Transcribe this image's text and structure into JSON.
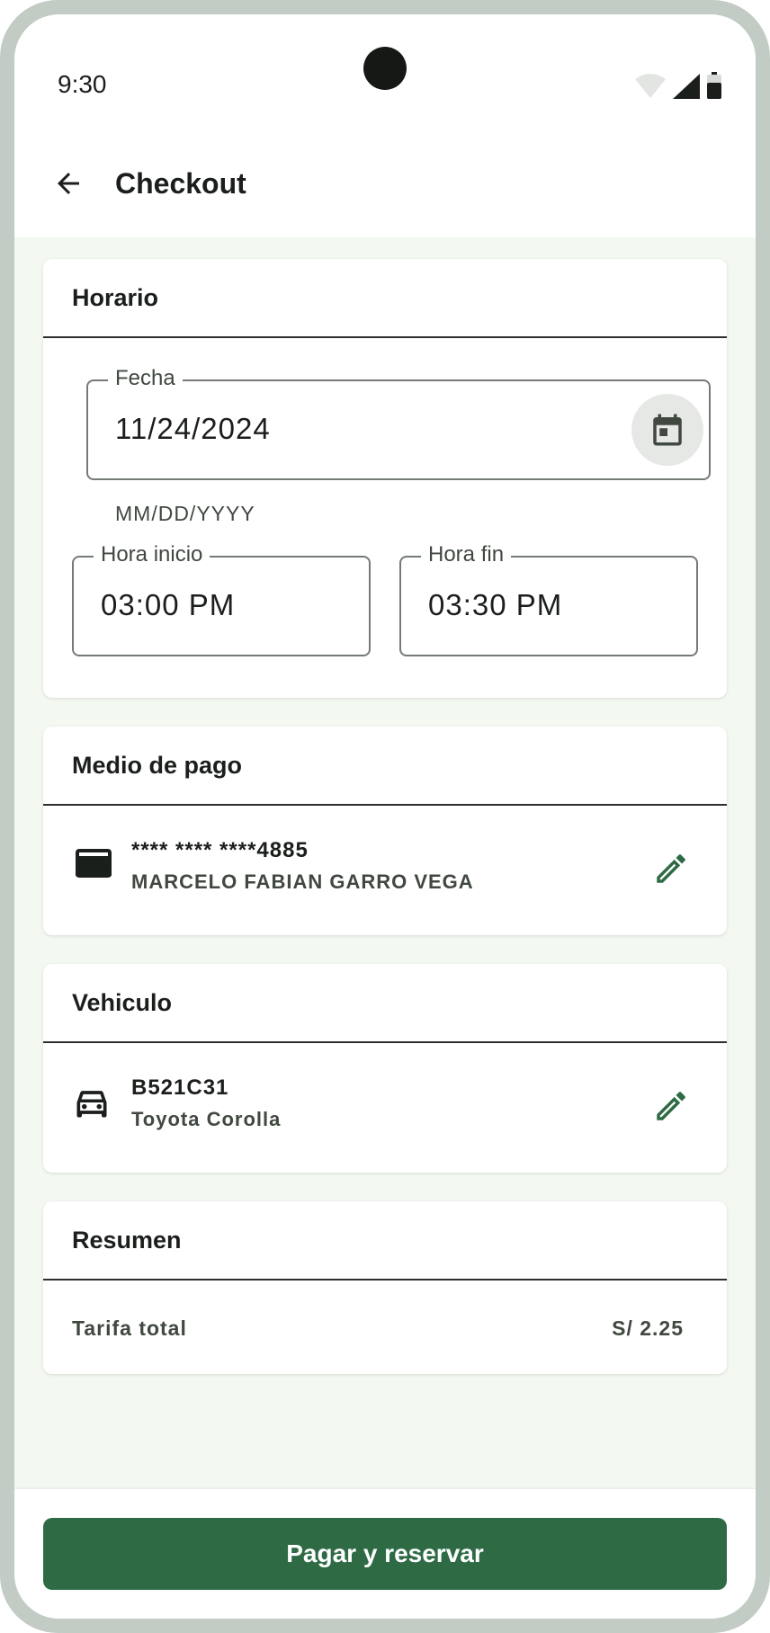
{
  "status_bar": {
    "time": "9:30"
  },
  "app_bar": {
    "title": "Checkout"
  },
  "horario": {
    "title": "Horario",
    "fecha": {
      "label": "Fecha",
      "value": "11/24/2024",
      "hint": "MM/DD/YYYY"
    },
    "hora_inicio": {
      "label": "Hora inicio",
      "value": "03:00 PM"
    },
    "hora_fin": {
      "label": "Hora fin",
      "value": "03:30 PM"
    }
  },
  "medio_pago": {
    "title": "Medio de pago",
    "card_number": "**** **** ****4885",
    "card_holder": "MARCELO FABIAN GARRO VEGA"
  },
  "vehiculo": {
    "title": "Vehiculo",
    "plate": "B521C31",
    "model": "Toyota Corolla"
  },
  "resumen": {
    "title": "Resumen",
    "label": "Tarifa total",
    "value": "S/ 2.25"
  },
  "actions": {
    "pay_label": "Pagar y reservar"
  },
  "colors": {
    "primary": "#2e6b45",
    "background": "#f3f8f1",
    "frame": "#c3ccc4"
  }
}
